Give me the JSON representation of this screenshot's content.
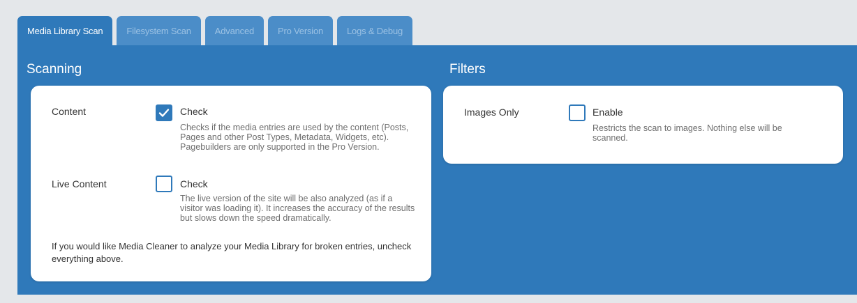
{
  "tabs": [
    {
      "label": "Media Library Scan",
      "active": true
    },
    {
      "label": "Filesystem Scan",
      "active": false
    },
    {
      "label": "Advanced",
      "active": false
    },
    {
      "label": "Pro Version",
      "active": false
    },
    {
      "label": "Logs & Debug",
      "active": false
    }
  ],
  "scanning": {
    "title": "Scanning",
    "content": {
      "label": "Content",
      "option_label": "Check",
      "checked": true,
      "description": "Checks if the media entries are used by the content (Posts, Pages and other Post Types, Metadata, Widgets, etc). Pagebuilders are only supported in the Pro Version."
    },
    "live_content": {
      "label": "Live Content",
      "option_label": "Check",
      "checked": false,
      "description": "The live version of the site will be also analyzed (as if a visitor was loading it). It increases the accuracy of the results but slows down the speed dramatically."
    },
    "note": "If you would like Media Cleaner to analyze your Media Library for broken entries, uncheck everything above."
  },
  "filters": {
    "title": "Filters",
    "images_only": {
      "label": "Images Only",
      "option_label": "Enable",
      "checked": false,
      "description": "Restricts the scan to images. Nothing else will be scanned."
    }
  },
  "colors": {
    "accent": "#2f79ba",
    "tab_inactive": "#4b8dc8",
    "background": "#e4e7ea"
  }
}
